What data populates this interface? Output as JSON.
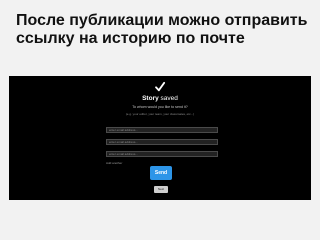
{
  "slide": {
    "title": "После публикации можно отправить ссылку на историю по почте"
  },
  "story_saved": {
    "check_icon": "check-icon",
    "story_word": "Story",
    "saved_word": "saved",
    "question": "To whom would you like to send it?",
    "hint": "(e.g. your editor, your team, your classmates, etc...)"
  },
  "form": {
    "email_placeholders": [
      "enter email address...",
      "enter email address...",
      "enter email address..."
    ],
    "add_more_label": "Add another",
    "send_label": "Send",
    "next_label": "Next"
  },
  "colors": {
    "slide_background": "#f2f2f2",
    "screen_background": "#000000",
    "send_button": "#2d95e8",
    "next_button": "#cfcfcf"
  }
}
